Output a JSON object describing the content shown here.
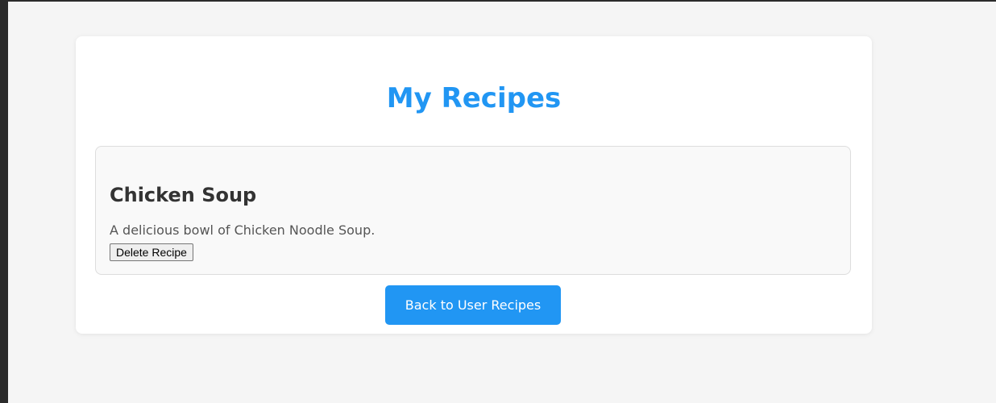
{
  "page": {
    "title": "My Recipes"
  },
  "recipes": [
    {
      "name": "Chicken Soup",
      "description": "A delicious bowl of Chicken Noodle Soup.",
      "delete_label": "Delete Recipe"
    }
  ],
  "actions": {
    "back_label": "Back to User Recipes"
  },
  "colors": {
    "accent": "#2196f3",
    "page_background": "#f5f5f5",
    "card_background": "#ffffff",
    "recipe_background": "#f9f9f9"
  }
}
